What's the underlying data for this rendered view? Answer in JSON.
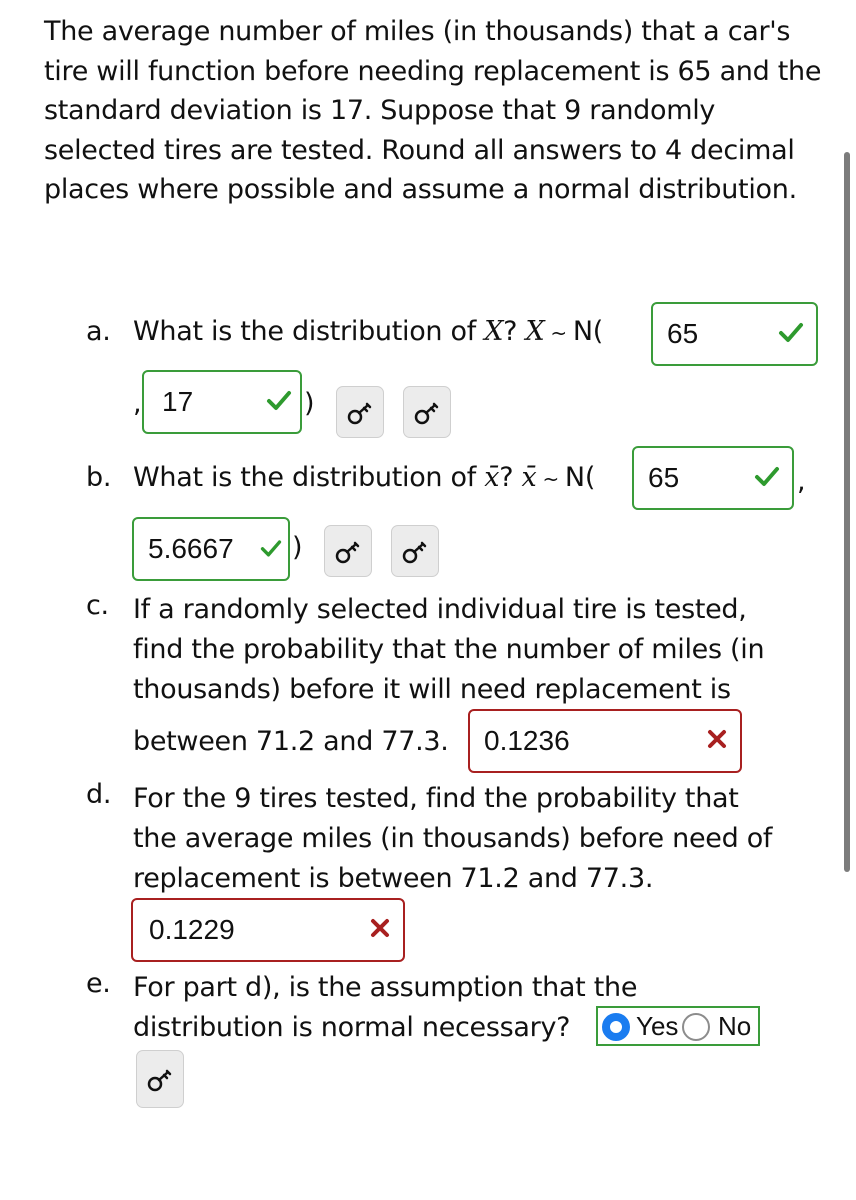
{
  "prompt": "The average number of miles (in thousands) that a car's tire will function before needing replacement is 65 and the standard deviation is 17. Suppose that 9 randomly selected tires are tested. Round all answers to 4 decimal places where possible and assume a normal distribution.",
  "part_a": {
    "marker": "a.",
    "text": "What is the distribution of",
    "var": "X",
    "q": "?",
    "var2": "X",
    "tilde": "~",
    "dist": "N(",
    "comma": ",",
    "close": ")",
    "mean": {
      "value": "65",
      "status": "correct"
    },
    "sd": {
      "value": "17",
      "status": "correct"
    }
  },
  "part_b": {
    "marker": "b.",
    "text": "What is the distribution of",
    "var": "x̄",
    "q": "?",
    "var2": "x̄",
    "tilde": "~",
    "dist": "N(",
    "comma": ",",
    "close": ")",
    "mean": {
      "value": "65",
      "status": "correct"
    },
    "sd": {
      "value": "5.6667",
      "status": "correct"
    }
  },
  "part_c": {
    "marker": "c.",
    "lines": [
      "If a randomly selected individual tire is tested,",
      "find the probability that the number of miles (in",
      "thousands) before it will need replacement is",
      "between 71.2 and 77.3."
    ],
    "answer": {
      "value": "0.1236",
      "status": "incorrect"
    }
  },
  "part_d": {
    "marker": "d.",
    "lines": [
      "For the 9 tires tested, find the probability that",
      "the average miles (in thousands) before need of",
      "replacement is between 71.2 and 77.3."
    ],
    "answer": {
      "value": "0.1229",
      "status": "incorrect"
    }
  },
  "part_e": {
    "marker": "e.",
    "lines": [
      "For part d), is the assumption that the",
      "distribution is normal necessary?"
    ],
    "options": [
      {
        "label": "Yes",
        "selected": true
      },
      {
        "label": "No",
        "selected": false
      }
    ]
  },
  "icons": {
    "correct": "checkmark-icon",
    "incorrect": "x-mark-icon",
    "help": "key-icon"
  },
  "colors": {
    "correct": "#2e9a2e",
    "incorrect": "#a82020",
    "radio_selected": "#1a7cf0"
  }
}
